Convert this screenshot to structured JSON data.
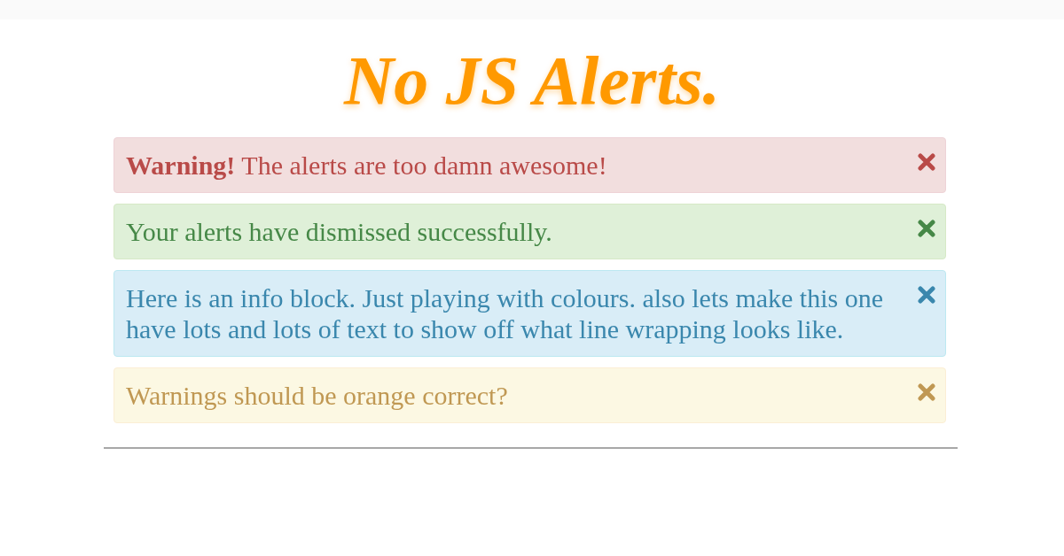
{
  "title": "No JS Alerts.",
  "alerts": [
    {
      "kind": "danger",
      "text": "**Warning!** The alerts are too damn awesome!"
    },
    {
      "kind": "success",
      "text": "Your alerts have dismissed successfully."
    },
    {
      "kind": "info",
      "text": "Here is an info block. Just playing with colours. also lets make this one have lots and lots of text to show off what line wrapping looks like."
    },
    {
      "kind": "warning",
      "text": "Warnings should be orange correct?"
    }
  ]
}
